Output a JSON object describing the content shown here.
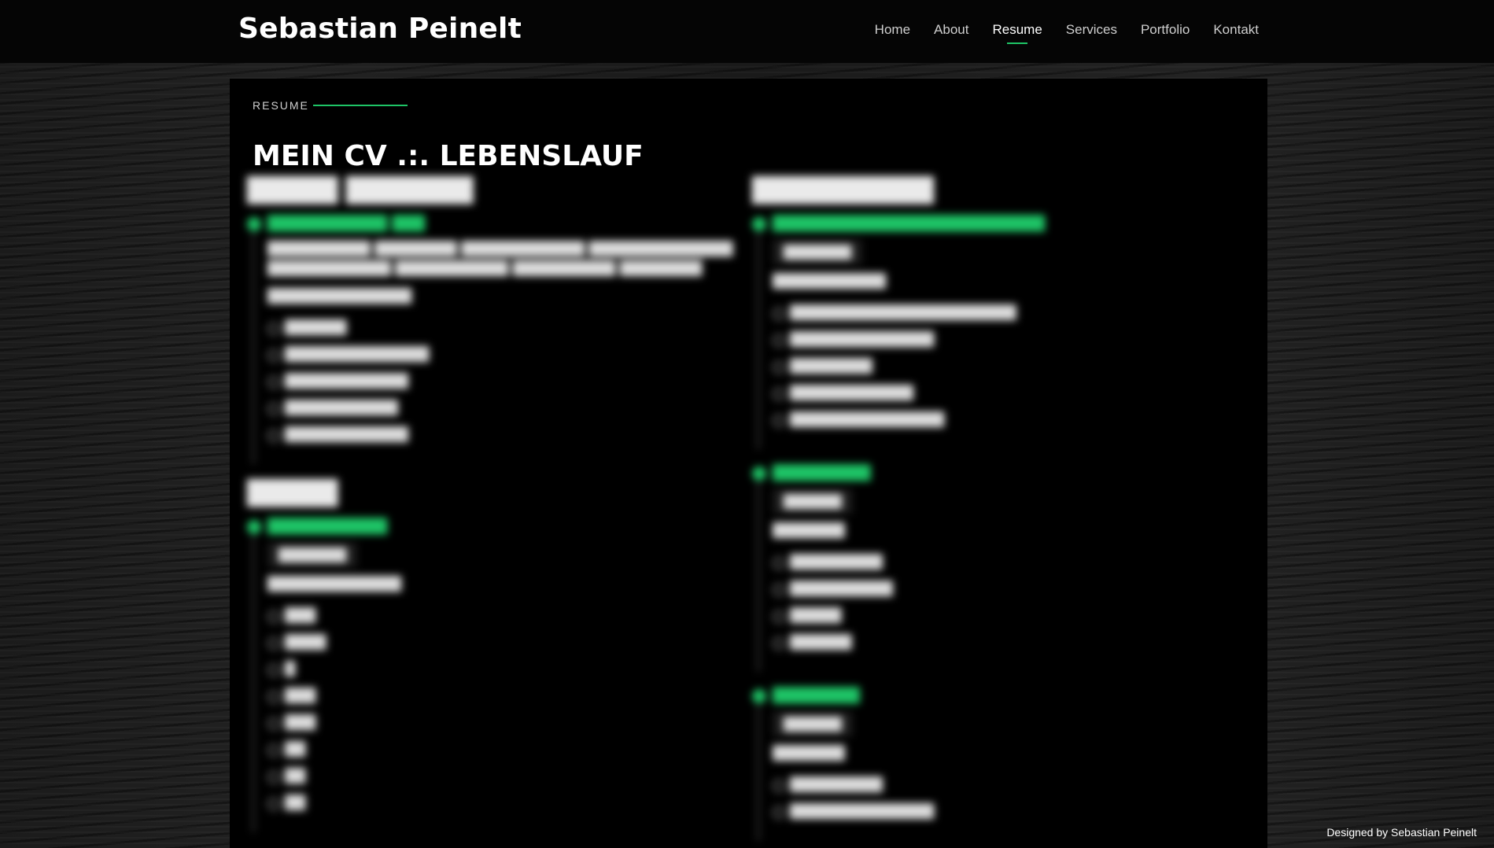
{
  "site": {
    "logo": "Sebastian Peinelt"
  },
  "nav": {
    "items": [
      {
        "label": "Home"
      },
      {
        "label": "About"
      },
      {
        "label": "Resume"
      },
      {
        "label": "Services"
      },
      {
        "label": "Portfolio"
      },
      {
        "label": "Kontakt"
      }
    ]
  },
  "section": {
    "label": "RESUME",
    "title": "MEIN CV .:. LEBENSLAUF"
  },
  "footer": {
    "credit": "Designed by Sebastian Peinelt"
  },
  "colors": {
    "accent": "#1ec466",
    "panel": "#000000",
    "header": "#050505"
  }
}
